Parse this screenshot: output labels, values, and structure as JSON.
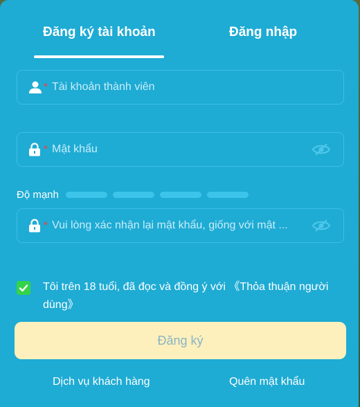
{
  "tabs": {
    "register": "Đăng ký tài khoản",
    "login": "Đăng nhập"
  },
  "form": {
    "username_placeholder": "Tài khoản thành viên",
    "password_placeholder": "Mật khẩu",
    "confirm_placeholder": "Vui lòng xác nhận lại mật khẩu, giống với mật ...",
    "required_mark": "*"
  },
  "strength": {
    "label": "Độ mạnh",
    "level": 0,
    "segments": 4
  },
  "agreement": {
    "text": "Tôi trên 18 tuổi, đã đọc và đồng ý với 《Thỏa thuận người dùng》",
    "checked": true
  },
  "submit_label": "Đăng ký",
  "footer": {
    "customer_service": "Dịch vụ khách hàng",
    "forgot_password": "Quên mật khẩu"
  },
  "colors": {
    "panel": "#1eabd4",
    "accent_button": "#fdf0bd",
    "checkbox": "#35d34a",
    "required": "#ff3b3b"
  },
  "icons": {
    "username": "user-icon",
    "password": "lock-icon",
    "toggle": "eye-hidden-icon",
    "checkbox": "checkmark-icon"
  }
}
